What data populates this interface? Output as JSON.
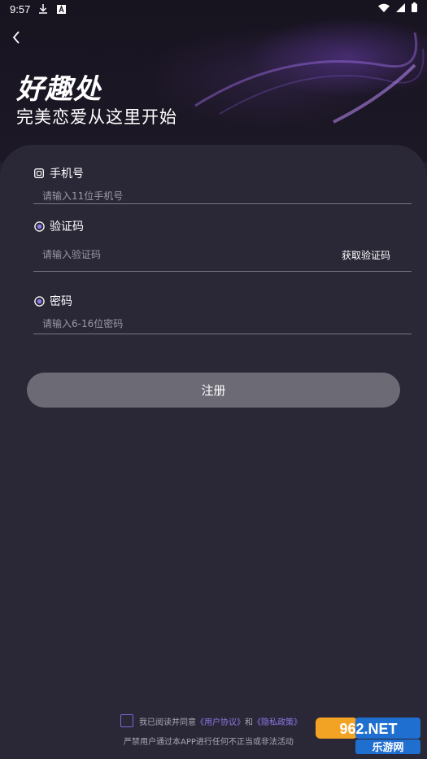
{
  "status_bar": {
    "time": "9:57",
    "icons": [
      "download-icon",
      "a-badge-icon",
      "wifi-icon",
      "signal-icon",
      "battery-icon"
    ]
  },
  "header": {
    "brand": "好趣处",
    "slogan": "完美恋爱从这里开始"
  },
  "form": {
    "phone": {
      "label": "手机号",
      "placeholder": "请输入11位手机号",
      "value": ""
    },
    "code": {
      "label": "验证码",
      "placeholder": "请输入验证码",
      "value": "",
      "get_code_label": "获取验证码"
    },
    "password": {
      "label": "密码",
      "placeholder": "请输入6-16位密码",
      "value": ""
    },
    "register_label": "注册"
  },
  "agreement": {
    "prefix": "我已阅读并同意",
    "user_agreement": "《用户协议》",
    "and": "和",
    "privacy_policy": "《隐私政策》",
    "checked": false
  },
  "disclaimer": "严禁用户通过本APP进行任何不正当或非法活动",
  "watermark": {
    "top": "962.NET",
    "bottom": "乐游网"
  },
  "colors": {
    "background": "#24212f",
    "card": "#2a2736",
    "accent": "#7d67d8",
    "button": "#6c6a75"
  }
}
